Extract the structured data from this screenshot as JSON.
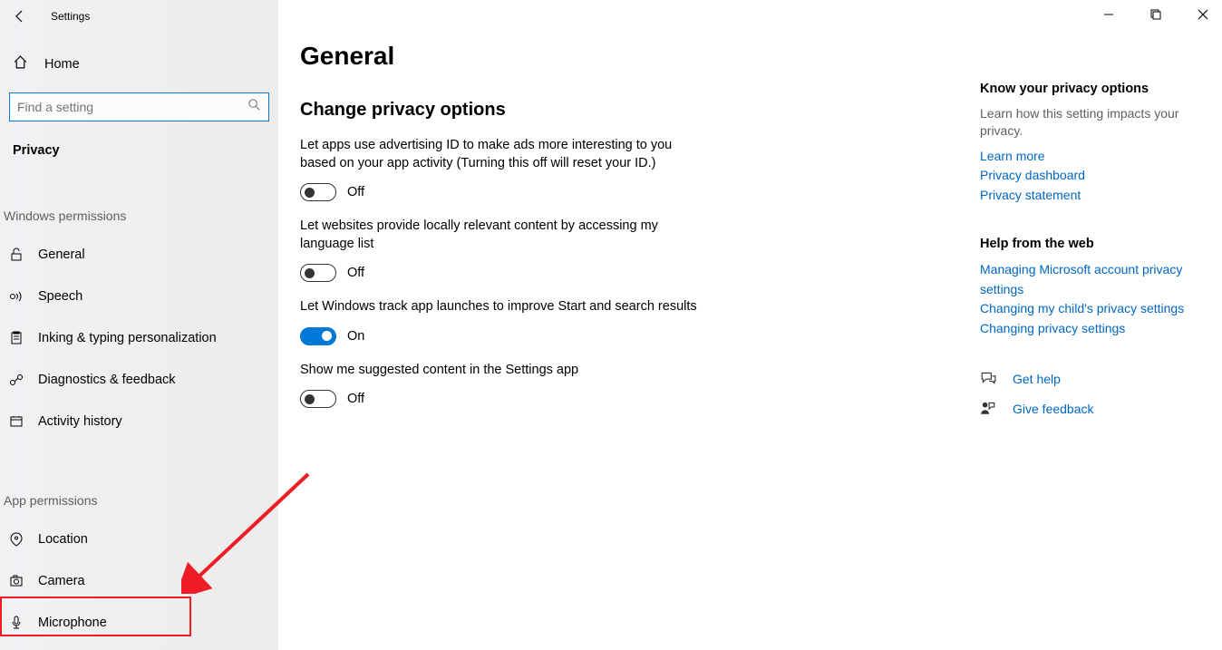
{
  "window_title": "Settings",
  "home_label": "Home",
  "search_placeholder": "Find a setting",
  "section_title": "Privacy",
  "group_windows": "Windows permissions",
  "group_app": "App permissions",
  "nav_windows": [
    {
      "label": "General"
    },
    {
      "label": "Speech"
    },
    {
      "label": "Inking & typing personalization"
    },
    {
      "label": "Diagnostics & feedback"
    },
    {
      "label": "Activity history"
    }
  ],
  "nav_app": [
    {
      "label": "Location"
    },
    {
      "label": "Camera"
    },
    {
      "label": "Microphone"
    }
  ],
  "main": {
    "title": "General",
    "subhead": "Change privacy options",
    "settings": [
      {
        "desc": "Let apps use advertising ID to make ads more interesting to you based on your app activity (Turning this off will reset your ID.)",
        "state": "Off"
      },
      {
        "desc": "Let websites provide locally relevant content by accessing my language list",
        "state": "Off"
      },
      {
        "desc": "Let Windows track app launches to improve Start and search results",
        "state": "On"
      },
      {
        "desc": "Show me suggested content in the Settings app",
        "state": "Off"
      }
    ]
  },
  "right": {
    "privacy_head": "Know your privacy options",
    "privacy_desc": "Learn how this setting impacts your privacy.",
    "links1": [
      "Learn more",
      "Privacy dashboard",
      "Privacy statement"
    ],
    "help_head": "Help from the web",
    "links2": [
      "Managing Microsoft account privacy settings",
      "Changing my child's privacy settings",
      "Changing privacy settings"
    ],
    "get_help": "Get help",
    "give_feedback": "Give feedback"
  }
}
